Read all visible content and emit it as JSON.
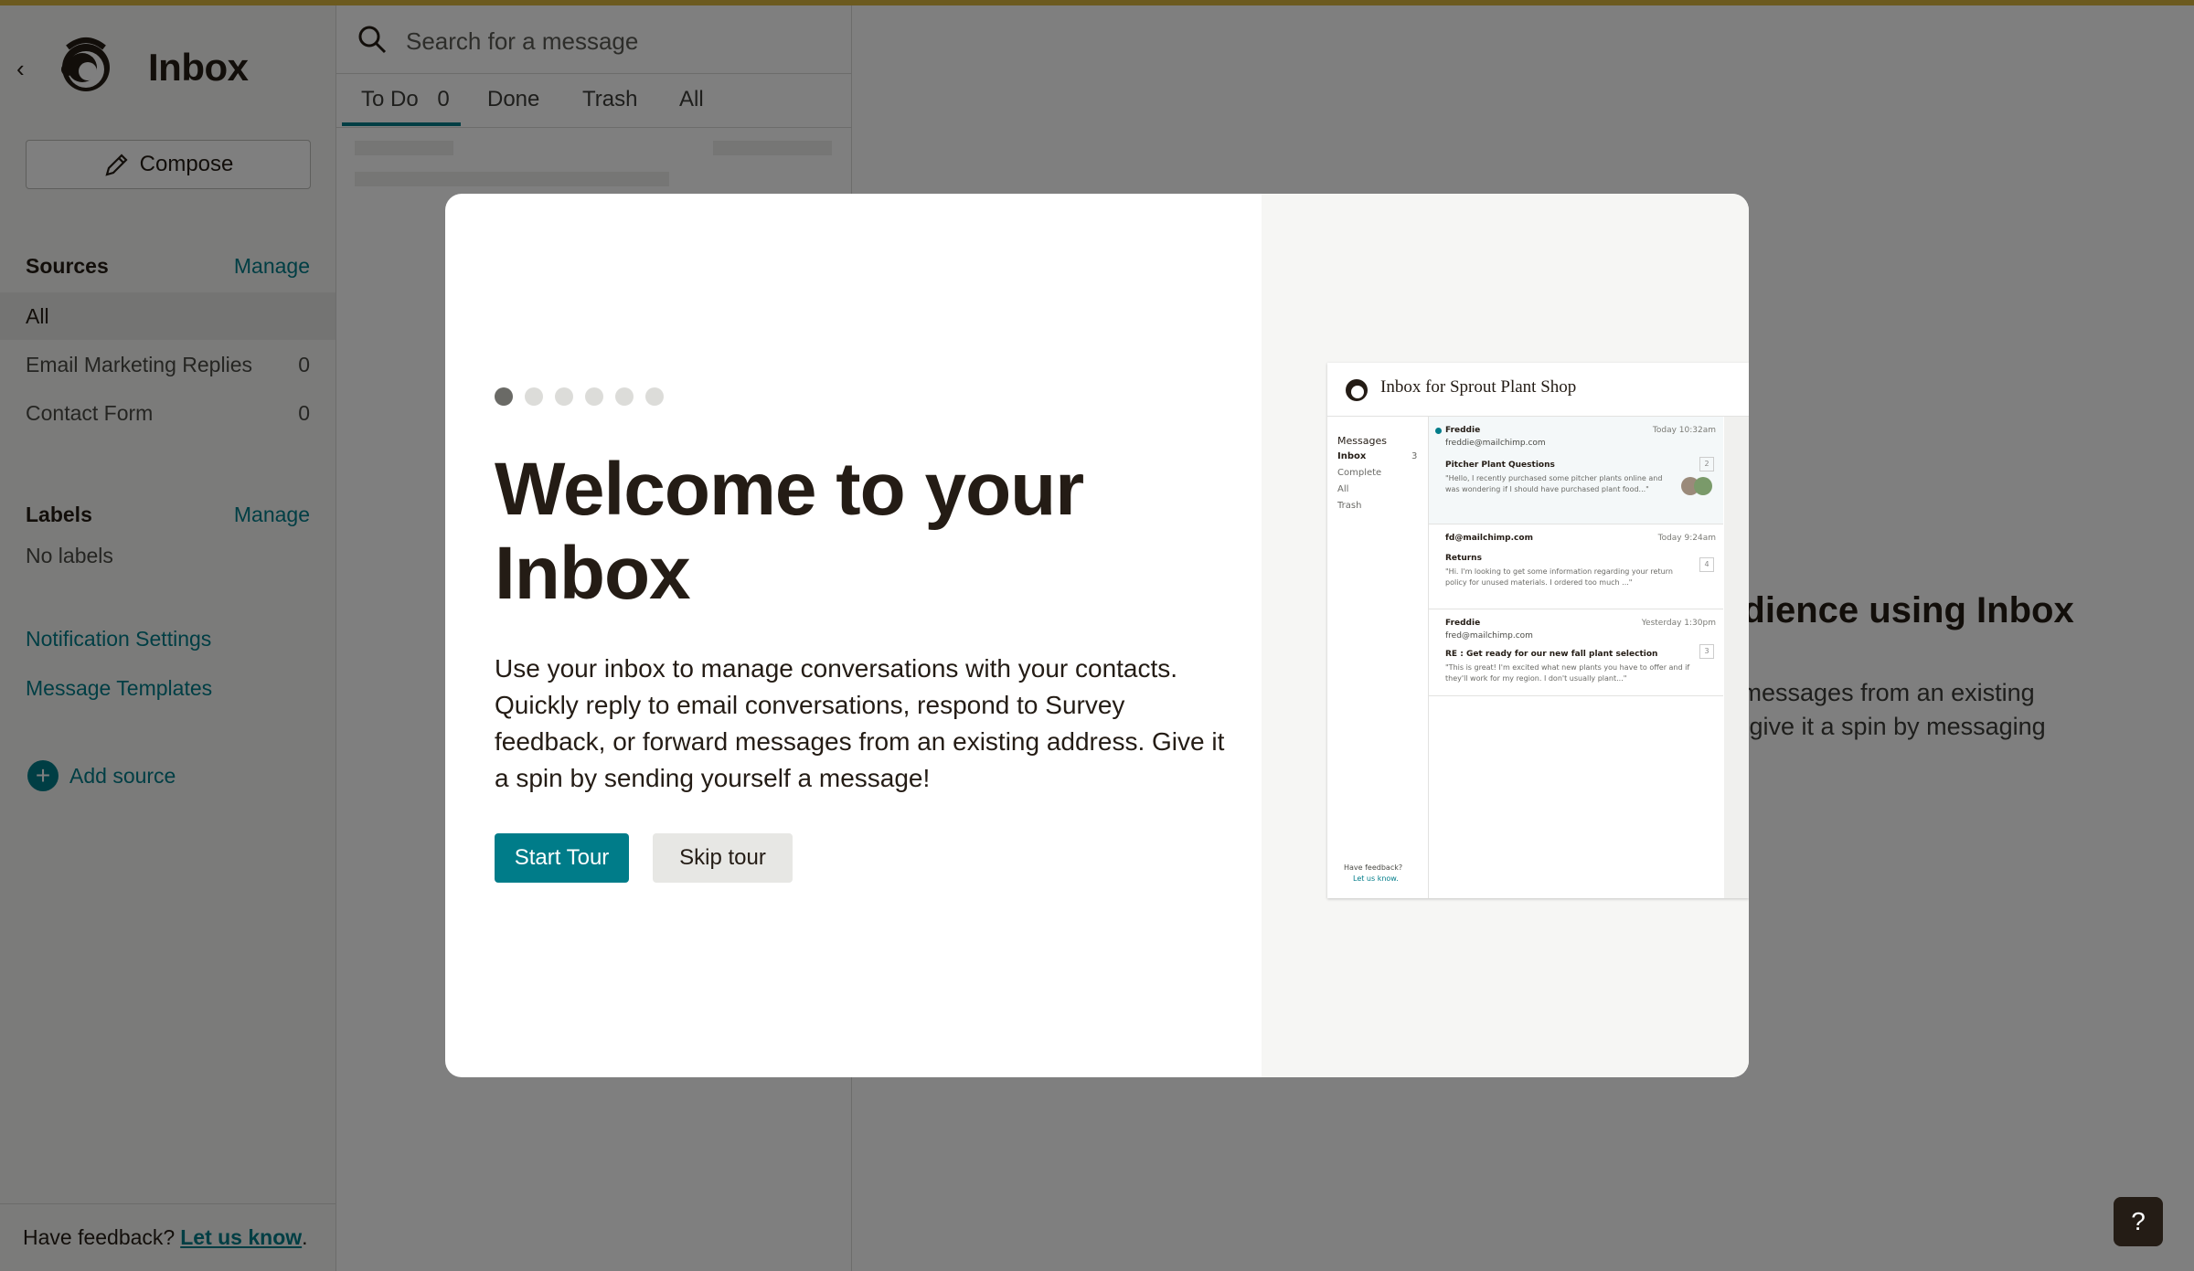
{
  "sidebar": {
    "title": "Inbox",
    "compose_label": "Compose",
    "sources": {
      "heading": "Sources",
      "manage": "Manage",
      "items": [
        {
          "label": "All",
          "count": ""
        },
        {
          "label": "Email Marketing Replies",
          "count": "0"
        },
        {
          "label": "Contact Form",
          "count": "0"
        }
      ]
    },
    "labels": {
      "heading": "Labels",
      "manage": "Manage",
      "empty": "No labels"
    },
    "links": {
      "notification_settings": "Notification Settings",
      "message_templates": "Message Templates",
      "add_source": "Add source"
    },
    "feedback": {
      "text": "Have feedback?",
      "link": "Let us know",
      "suffix": "."
    }
  },
  "list": {
    "search_placeholder": "Search for a message",
    "tabs": [
      {
        "label": "To Do",
        "count": "0"
      },
      {
        "label": "Done"
      },
      {
        "label": "Trash"
      },
      {
        "label": "All"
      }
    ]
  },
  "background": {
    "heading_fragment": "udience using Inbox",
    "desc_line1": "d messages from an existing",
    "desc_line2": "or give it a spin by messaging"
  },
  "help_label": "?",
  "modal": {
    "step_current": 1,
    "step_total": 6,
    "title": "Welcome to your Inbox",
    "description": "Use your inbox to manage conversations with your contacts. Quickly reply to email conversations, respond to Survey feedback, or forward messages from an existing address. Give it a spin by sending yourself a message!",
    "start_label": "Start Tour",
    "skip_label": "Skip tour",
    "preview": {
      "title": "Inbox for Sprout Plant Shop",
      "nav": [
        "Messages",
        "Inbox",
        "Complete",
        "All",
        "Trash"
      ],
      "nav_count": "3",
      "messages": [
        {
          "from": "Freddie",
          "email": "freddie@mailchimp.com",
          "time": "Today 10:32am",
          "subject": "Pitcher Plant Questions",
          "snippet": "\"Hello, I recently purchased some pitcher plants online and was wondering if I should have purchased plant food...\"",
          "count": "2"
        },
        {
          "from": "fd@mailchimp.com",
          "email": "",
          "time": "Today 9:24am",
          "subject": "Returns",
          "snippet": "\"Hi. I'm looking to get some information regarding your return policy for unused materials. I ordered too much ...\"",
          "count": "4"
        },
        {
          "from": "Freddie",
          "email": "fred@mailchimp.com",
          "time": "Yesterday 1:30pm",
          "subject": "RE : Get ready for our new fall plant selection",
          "snippet": "\"This is great! I'm excited what new plants you have to offer and if they'll work for my region. I don't usually plant...\"",
          "count": "3"
        }
      ],
      "feedback": "Have feedback?",
      "feedback_link": "Let us know."
    }
  },
  "colors": {
    "accent": "#007c89",
    "topbar": "#d8b53f",
    "text": "#241c15"
  }
}
